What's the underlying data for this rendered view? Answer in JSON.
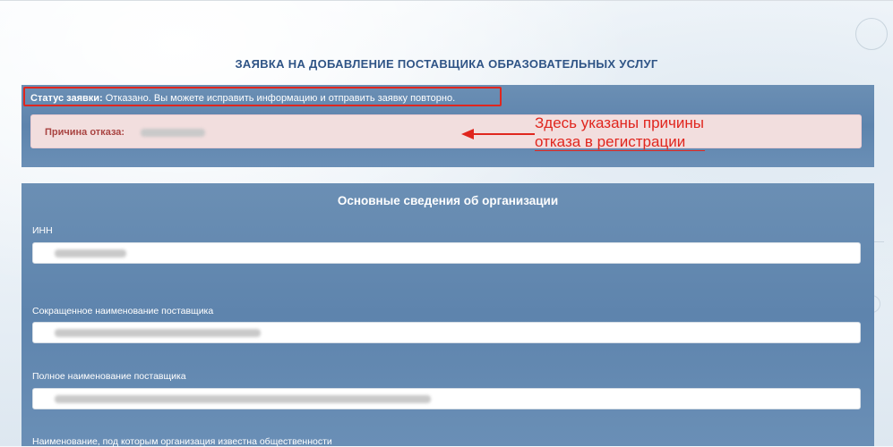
{
  "page": {
    "title": "ЗАЯВКА НА ДОБАВЛЕНИЕ ПОСТАВЩИКА ОБРАЗОВАТЕЛЬНЫХ УСЛУГ"
  },
  "status": {
    "label": "Статус заявки:",
    "text": " Отказано. Вы можете исправить информацию и отправить заявку повторно.",
    "reason_label": "Причина отказа:"
  },
  "annotation": {
    "text": "Здесь указаны причины\nотказа в регистрации"
  },
  "main": {
    "section_title": "Основные сведения об организации",
    "fields": [
      {
        "label": "ИНН",
        "value": ""
      },
      {
        "label": "Сокращенное наименование поставщика",
        "value": ""
      },
      {
        "label": "Полное наименование поставщика",
        "value": ""
      },
      {
        "label": "Наименование, под которым организация известна общественности",
        "value": ""
      }
    ]
  },
  "colors": {
    "title": "#2f5486",
    "panel": "#6385ad",
    "alert_bg": "#f2dede",
    "alert_text": "#a94442",
    "highlight": "#e0261e"
  }
}
